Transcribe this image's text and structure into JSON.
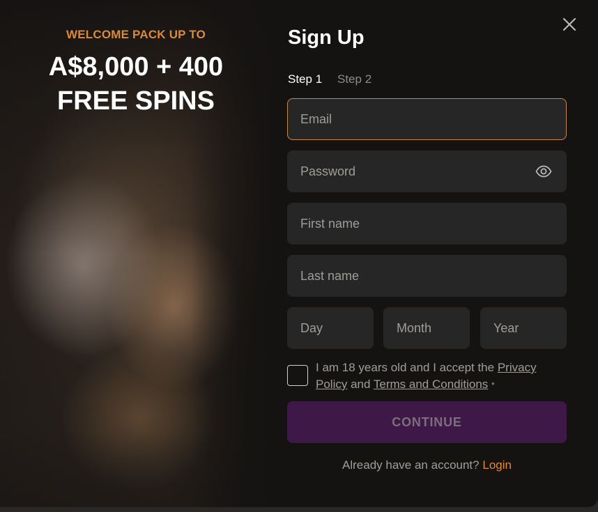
{
  "promo": {
    "kicker": "WELCOME PACK UP TO",
    "amount": "A$8,000 + 400",
    "spins": "FREE SPINS"
  },
  "form": {
    "title": "Sign Up",
    "steps": [
      "Step 1",
      "Step 2"
    ],
    "email_placeholder": "Email",
    "password_placeholder": "Password",
    "first_name_placeholder": "First name",
    "last_name_placeholder": "Last name",
    "day_placeholder": "Day",
    "month_placeholder": "Month",
    "year_placeholder": "Year",
    "consent_prefix": "I am 18 years old and I accept the",
    "privacy_link": "Privacy Policy",
    "consent_and": "and",
    "terms_link": "Terms and Conditions",
    "required_mark": "*",
    "continue_label": "CONTINUE",
    "login_prompt": "Already have an account?",
    "login_link": "Login"
  },
  "icons": {
    "close": "close-icon",
    "eye": "eye-icon"
  },
  "colors": {
    "accent": "#d98a3d",
    "button_bg": "#3e1846",
    "field_bg": "#262626",
    "modal_bg": "#151312"
  }
}
